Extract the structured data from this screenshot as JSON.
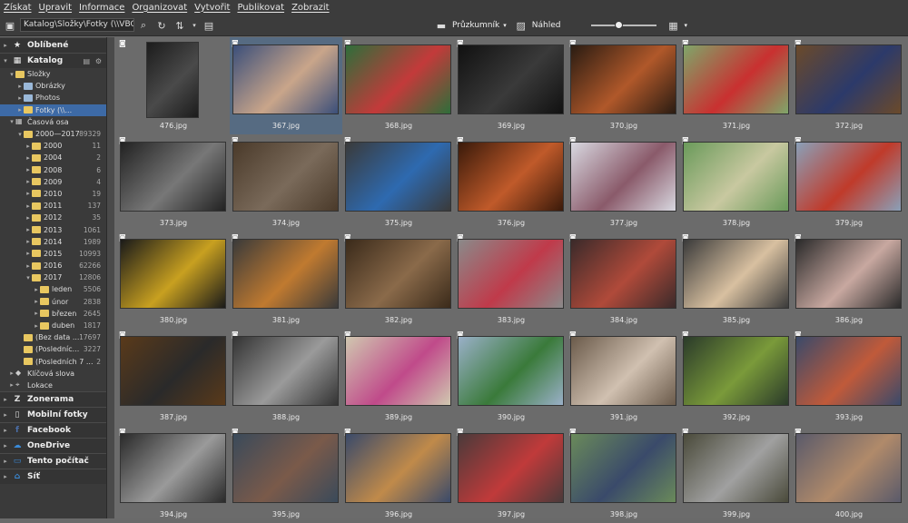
{
  "menu": [
    "Získat",
    "Upravit",
    "Informace",
    "Organizovat",
    "Vytvořit",
    "Publikovat",
    "Zobrazit"
  ],
  "toolbar": {
    "address": "Katalog\\Složky\\Fotky (\\\\VBO...\\JPEG",
    "view_label": "Průzkumník",
    "preview_label": "Náhled",
    "zoom_level": 0.4
  },
  "sidebar": {
    "sections": [
      {
        "label": "Oblíbené",
        "icon": "star-icon"
      },
      {
        "label": "Katalog",
        "icon": "catalog-icon"
      }
    ],
    "tree": [
      {
        "label": "Složky",
        "count": "",
        "indent": 1,
        "expanded": true
      },
      {
        "label": "Obrázky",
        "count": "",
        "indent": 2
      },
      {
        "label": "Photos",
        "count": "",
        "indent": 2
      },
      {
        "label": "Fotky (\\\\...",
        "count": "",
        "indent": 2,
        "selected": true
      },
      {
        "label": "Časová osa",
        "count": "",
        "indent": 1,
        "expanded": true
      },
      {
        "label": "2000—2017",
        "count": "89329",
        "indent": 2,
        "expanded": true
      },
      {
        "label": "2000",
        "count": "11",
        "indent": 3
      },
      {
        "label": "2004",
        "count": "2",
        "indent": 3
      },
      {
        "label": "2008",
        "count": "6",
        "indent": 3
      },
      {
        "label": "2009",
        "count": "4",
        "indent": 3
      },
      {
        "label": "2010",
        "count": "19",
        "indent": 3
      },
      {
        "label": "2011",
        "count": "137",
        "indent": 3
      },
      {
        "label": "2012",
        "count": "35",
        "indent": 3
      },
      {
        "label": "2013",
        "count": "1061",
        "indent": 3
      },
      {
        "label": "2014",
        "count": "1989",
        "indent": 3
      },
      {
        "label": "2015",
        "count": "10993",
        "indent": 3
      },
      {
        "label": "2016",
        "count": "62266",
        "indent": 3
      },
      {
        "label": "2017",
        "count": "12806",
        "indent": 3,
        "expanded": true
      },
      {
        "label": "leden",
        "count": "5506",
        "indent": 4
      },
      {
        "label": "únor",
        "count": "2838",
        "indent": 4
      },
      {
        "label": "březen",
        "count": "2645",
        "indent": 4
      },
      {
        "label": "duben",
        "count": "1817",
        "indent": 4
      },
      {
        "label": "(Bez data ...",
        "count": "17697",
        "indent": 2
      },
      {
        "label": "(Posledníc...",
        "count": "3227",
        "indent": 2
      },
      {
        "label": "(Posledních 7 ...",
        "count": "2",
        "indent": 2
      },
      {
        "label": "Klíčová slova",
        "count": "",
        "indent": 1
      },
      {
        "label": "Lokace",
        "count": "",
        "indent": 1
      }
    ],
    "groups": [
      {
        "label": "Zonerama",
        "icon": "zonerama-icon"
      },
      {
        "label": "Mobilní fotky",
        "icon": "phone-icon"
      },
      {
        "label": "Facebook",
        "icon": "facebook-icon"
      },
      {
        "label": "OneDrive",
        "icon": "cloud-icon"
      },
      {
        "label": "Tento počítač",
        "icon": "computer-icon"
      },
      {
        "label": "Síť",
        "icon": "network-icon"
      }
    ]
  },
  "photos": [
    {
      "name": "476.jpg",
      "portrait": true,
      "tone": [
        "#1c1c1c",
        "#4a4a4a"
      ]
    },
    {
      "name": "367.jpg",
      "selected": true,
      "tone": [
        "#3b4f7a",
        "#c9a58a"
      ]
    },
    {
      "name": "368.jpg",
      "tone": [
        "#2e6e3a",
        "#c33a3a"
      ]
    },
    {
      "name": "369.jpg",
      "tone": [
        "#111111",
        "#3a3a3a"
      ]
    },
    {
      "name": "370.jpg",
      "tone": [
        "#2a1c12",
        "#b0582a"
      ]
    },
    {
      "name": "371.jpg",
      "tone": [
        "#7fa66a",
        "#c93030"
      ]
    },
    {
      "name": "372.jpg",
      "tone": [
        "#6b4a2a",
        "#2c3a6a"
      ]
    },
    {
      "name": "373.jpg",
      "tone": [
        "#222222",
        "#777777"
      ]
    },
    {
      "name": "374.jpg",
      "tone": [
        "#4a3a2a",
        "#7a6a5a"
      ]
    },
    {
      "name": "375.jpg",
      "tone": [
        "#3a3a3a",
        "#2e6ab0"
      ]
    },
    {
      "name": "376.jpg",
      "tone": [
        "#3a1a0a",
        "#c05a2a"
      ]
    },
    {
      "name": "377.jpg",
      "tone": [
        "#d8d8e0",
        "#8a5a6a"
      ]
    },
    {
      "name": "378.jpg",
      "tone": [
        "#6a9a5a",
        "#c8c8a0"
      ]
    },
    {
      "name": "379.jpg",
      "tone": [
        "#8aa0b8",
        "#c03a2a"
      ]
    },
    {
      "name": "380.jpg",
      "tone": [
        "#1a1a1a",
        "#c8a020"
      ]
    },
    {
      "name": "381.jpg",
      "tone": [
        "#3a3a3a",
        "#c07a30"
      ]
    },
    {
      "name": "382.jpg",
      "tone": [
        "#3a2a1a",
        "#8a6a4a"
      ]
    },
    {
      "name": "383.jpg",
      "tone": [
        "#8a8a8a",
        "#c03a4a"
      ]
    },
    {
      "name": "384.jpg",
      "tone": [
        "#3a2a2a",
        "#b04a3a"
      ]
    },
    {
      "name": "385.jpg",
      "tone": [
        "#3a3a3a",
        "#d8c0a0"
      ]
    },
    {
      "name": "386.jpg",
      "tone": [
        "#2a2a2a",
        "#c8a8a0"
      ]
    },
    {
      "name": "387.jpg",
      "tone": [
        "#5a3a1a",
        "#2a2a2a"
      ]
    },
    {
      "name": "388.jpg",
      "tone": [
        "#333333",
        "#9a9a9a"
      ]
    },
    {
      "name": "389.jpg",
      "tone": [
        "#d0c8b0",
        "#c04a8a"
      ]
    },
    {
      "name": "390.jpg",
      "tone": [
        "#9ab0c8",
        "#3a7a3a"
      ]
    },
    {
      "name": "391.jpg",
      "tone": [
        "#6a5a4a",
        "#d0c0b0"
      ]
    },
    {
      "name": "392.jpg",
      "tone": [
        "#2a3a2a",
        "#7a9a3a"
      ]
    },
    {
      "name": "393.jpg",
      "tone": [
        "#3a4a6a",
        "#c05a3a"
      ]
    },
    {
      "name": "394.jpg",
      "tone": [
        "#2a2a2a",
        "#9a9a9a"
      ]
    },
    {
      "name": "395.jpg",
      "tone": [
        "#3a4a5a",
        "#7a5a4a"
      ]
    },
    {
      "name": "396.jpg",
      "tone": [
        "#3a4a6a",
        "#c08a4a"
      ]
    },
    {
      "name": "397.jpg",
      "tone": [
        "#4a3a3a",
        "#c03a3a"
      ]
    },
    {
      "name": "398.jpg",
      "tone": [
        "#6a8a5a",
        "#3a4a6a"
      ]
    },
    {
      "name": "399.jpg",
      "tone": [
        "#4a4a3a",
        "#a0a0a0"
      ]
    },
    {
      "name": "400.jpg",
      "tone": [
        "#5a5a6a",
        "#b08a6a"
      ]
    }
  ]
}
